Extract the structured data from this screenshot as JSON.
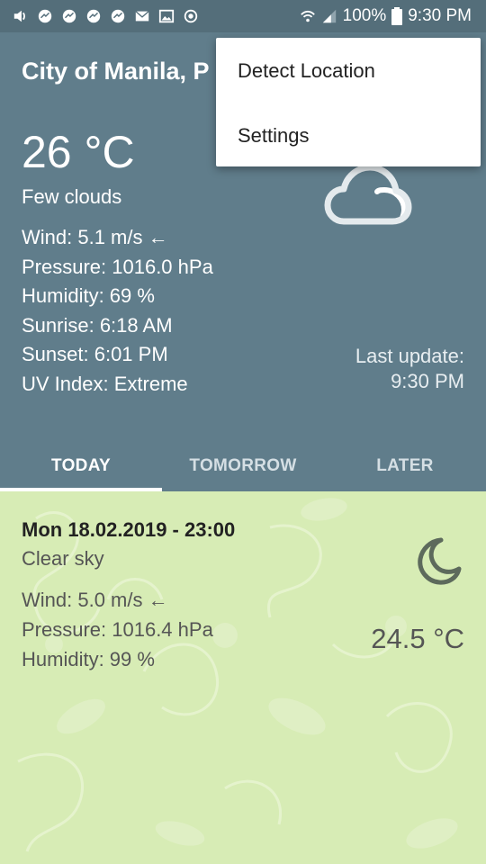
{
  "status_bar": {
    "battery": "100%",
    "time": "9:30 PM",
    "icons": [
      "volume-icon",
      "messenger-icon",
      "messenger-icon",
      "messenger-icon",
      "messenger-icon",
      "mail-icon",
      "image-icon",
      "sync-icon",
      "wifi-icon",
      "signal-icon",
      "battery-icon"
    ]
  },
  "header": {
    "city": "City of Manila, P",
    "temperature": "26 °C",
    "description": "Few clouds",
    "wind": "Wind: 5.1 m/s ←",
    "pressure": "Pressure: 1016.0 hPa",
    "humidity": "Humidity: 69 %",
    "sunrise": "Sunrise: 6:18 AM",
    "sunset": "Sunset: 6:01 PM",
    "uv_index": "UV Index: Extreme",
    "last_update_label": "Last update:",
    "last_update_time": "9:30 PM",
    "icon": "cloud-icon"
  },
  "tabs": [
    {
      "label": "TODAY",
      "active": true
    },
    {
      "label": "TOMORROW",
      "active": false
    },
    {
      "label": "LATER",
      "active": false
    }
  ],
  "forecast": {
    "date": "Mon 18.02.2019 - 23:00",
    "description": "Clear sky",
    "wind": "Wind: 5.0 m/s ←",
    "pressure": "Pressure: 1016.4 hPa",
    "humidity": "Humidity: 99 %",
    "temperature": "24.5 °C",
    "icon": "moon-icon"
  },
  "menu": {
    "items": [
      "Detect Location",
      "Settings"
    ]
  },
  "colors": {
    "header_bg": "#607d8b",
    "status_bg": "#546e7a",
    "content_bg": "#d7ecb5"
  }
}
